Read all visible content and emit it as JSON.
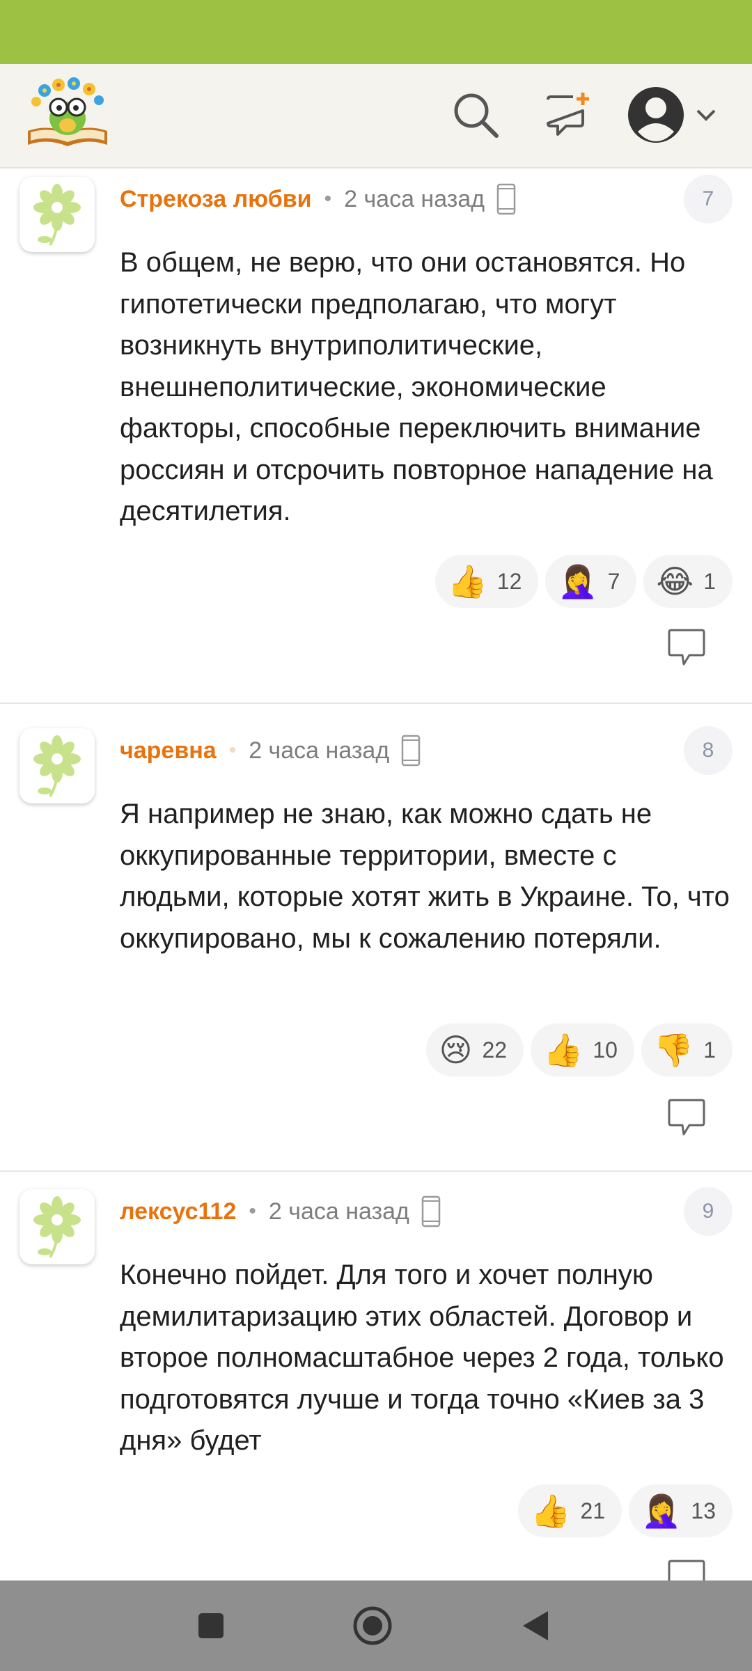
{
  "comments": [
    {
      "author": "Стрекоза любви",
      "time": "2 часа назад",
      "number": "7",
      "text": "В общем, не верю, что они остановятся. Но гипотетически предполагаю, что могут возникнуть внутриполитические, внешнеполитические, экономические факторы, способные переключить внимание россиян и отсрочить повторное нападение на десятилетия.",
      "reactions": [
        {
          "emoji": "👍",
          "count": "12"
        },
        {
          "emoji": "🤦‍♀️",
          "count": "7"
        },
        {
          "emoji": "😂",
          "count": "1"
        }
      ]
    },
    {
      "author": "чаревна",
      "time": "2 часа назад",
      "number": "8",
      "text": "Я например не знаю, как можно сдать не оккупированные территории, вместе с людьми, которые хотят жить в Украине. То, что оккупировано, мы к сожалению потеряли.",
      "reactions": [
        {
          "emoji": "😢",
          "count": "22"
        },
        {
          "emoji": "👍",
          "count": "10"
        },
        {
          "emoji": "👎",
          "count": "1"
        }
      ]
    },
    {
      "author": "лексус112",
      "time": "2 часа назад",
      "number": "9",
      "text": "Конечно пойдет. Для того и хочет полную демилитаризацию этих областей. Договор и второе полномасштабное через 2 года, только подготовятся лучше и тогда точно «Киев за 3 дня» будет",
      "reactions": [
        {
          "emoji": "👍",
          "count": "21"
        },
        {
          "emoji": "🤦‍♀️",
          "count": "13"
        }
      ]
    }
  ],
  "colors": {
    "status_bar": "#9dc143",
    "author": "#e8730e",
    "nav_bar": "#8f8f8f"
  },
  "icons": {
    "logo": "owl-with-flowers-on-book-logo",
    "search": "search-icon",
    "new_post": "new-post-icon",
    "profile": "avatar-icon",
    "device": "phone-icon",
    "reply": "reply-icon",
    "nav": [
      "square-icon",
      "home-circle-icon",
      "back-triangle-icon"
    ]
  }
}
